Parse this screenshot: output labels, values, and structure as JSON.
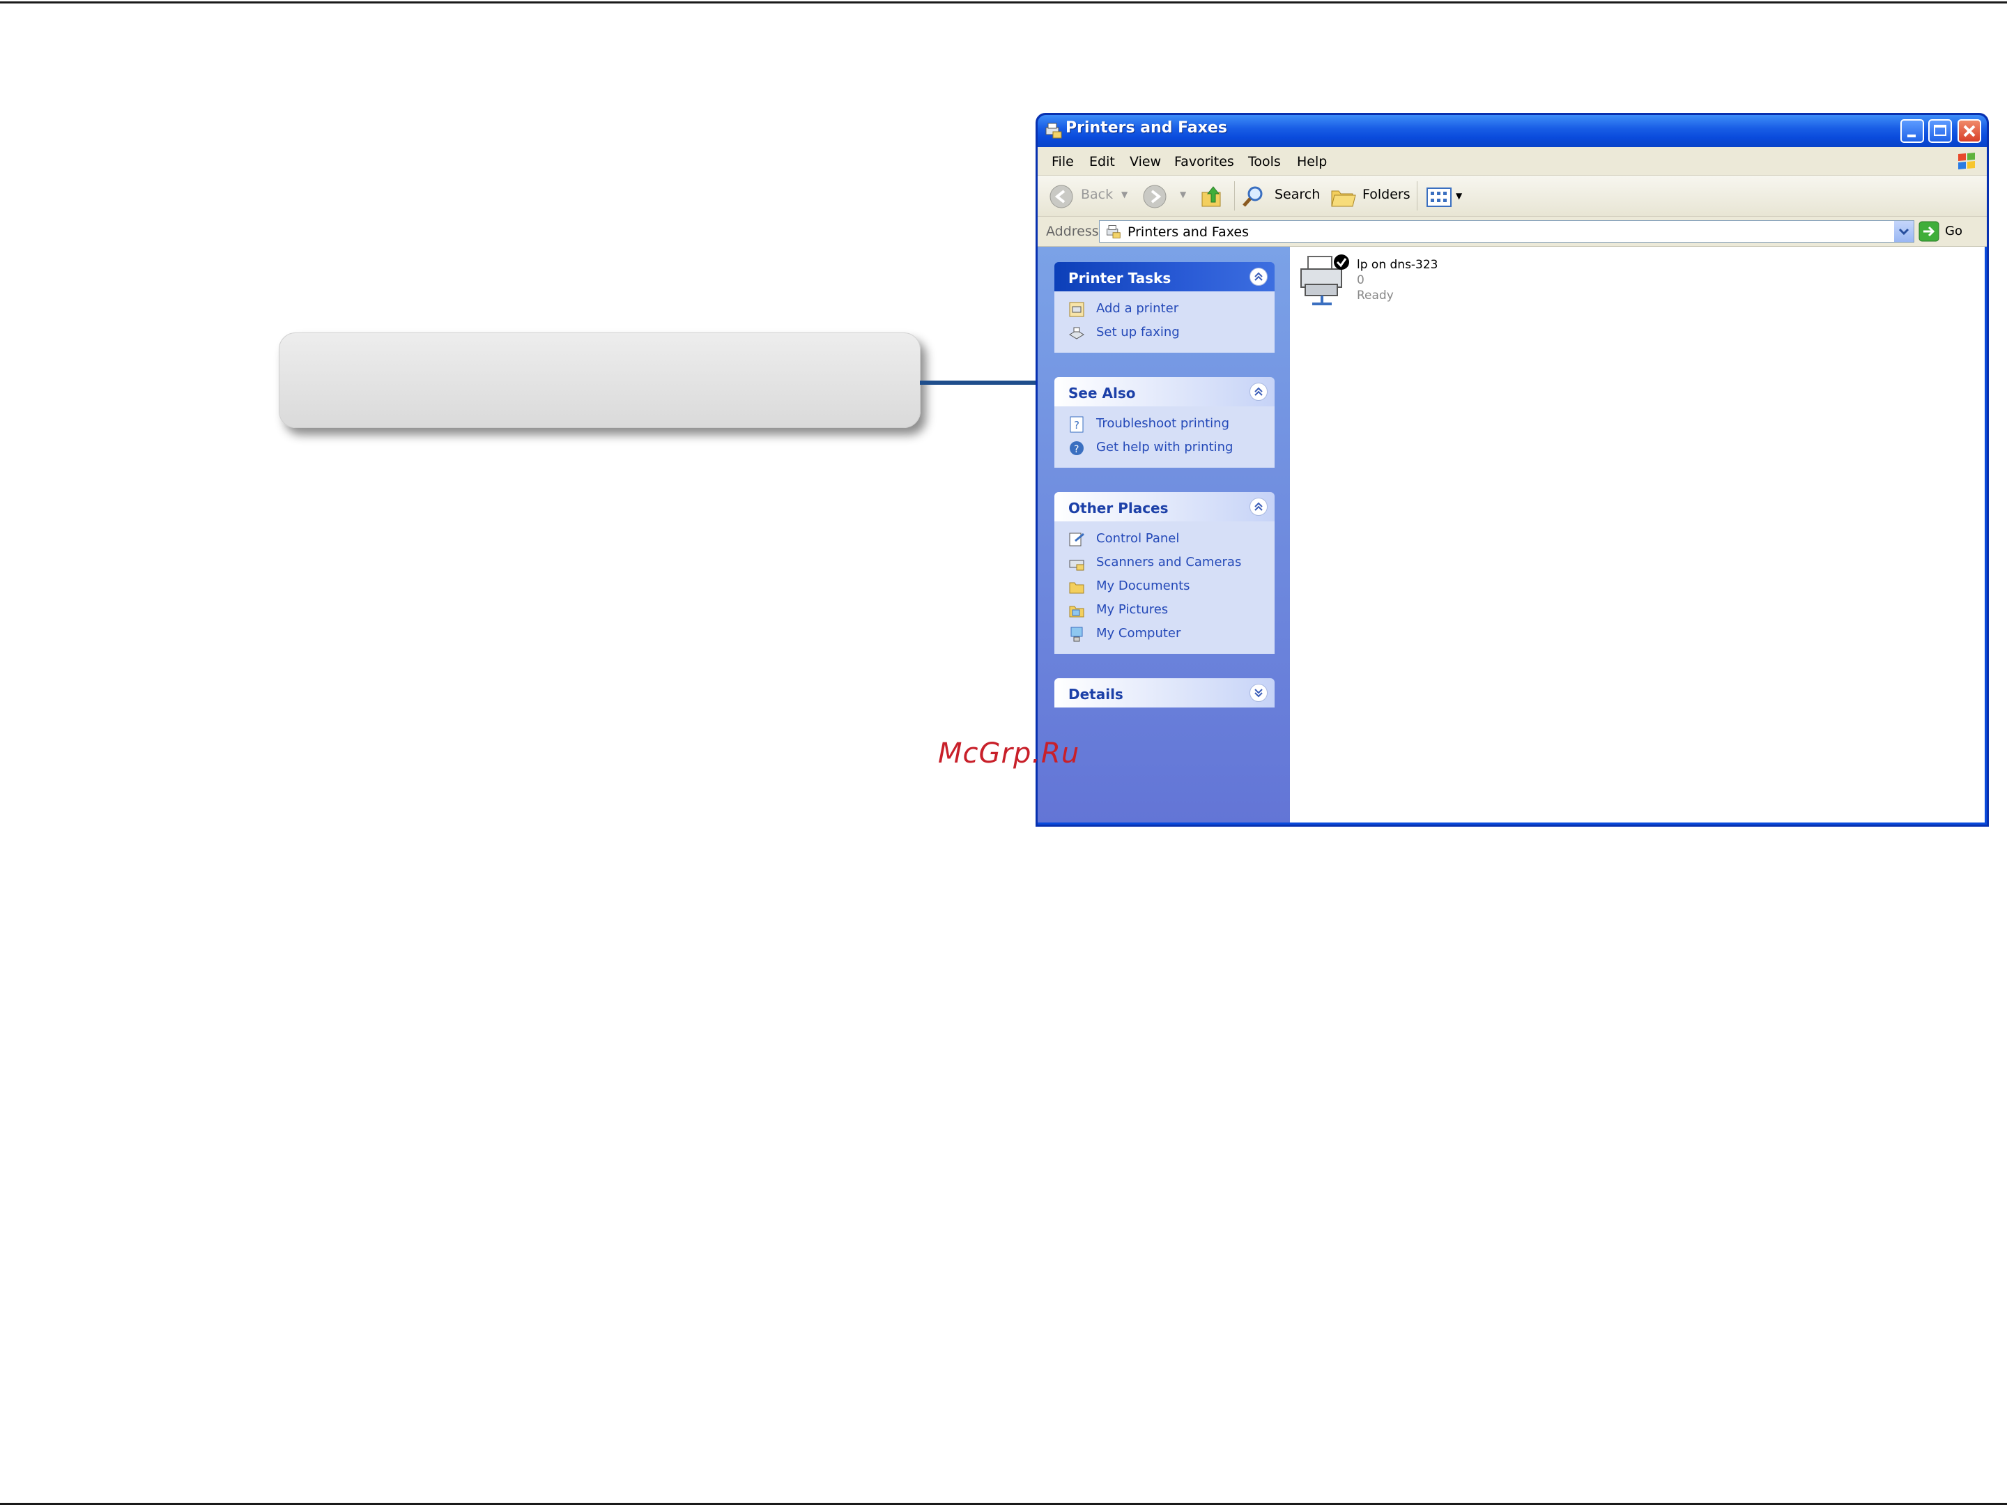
{
  "window": {
    "title": "Printers and Faxes",
    "menu": [
      "File",
      "Edit",
      "View",
      "Favorites",
      "Tools",
      "Help"
    ],
    "toolbar": {
      "back": "Back",
      "search": "Search",
      "folders": "Folders"
    },
    "address": {
      "label": "Address",
      "value": "Printers and Faxes",
      "go": "Go"
    }
  },
  "panels": [
    {
      "title": "Printer Tasks",
      "style": "dark",
      "items": [
        "Add a printer",
        "Set up faxing"
      ]
    },
    {
      "title": "See Also",
      "style": "light",
      "items": [
        "Troubleshoot printing",
        "Get help with printing"
      ]
    },
    {
      "title": "Other Places",
      "style": "light",
      "items": [
        "Control Panel",
        "Scanners and Cameras",
        "My Documents",
        "My Pictures",
        "My Computer"
      ]
    },
    {
      "title": "Details",
      "style": "light",
      "items": []
    }
  ],
  "printer": {
    "name": "lp on dns-323",
    "jobs": "0",
    "status": "Ready"
  },
  "watermark": "McGrp.Ru",
  "colors": {
    "accent": "#0a4bdc",
    "link": "#2449b8",
    "connector": "#1f4e8c",
    "watermark": "#c8202a"
  }
}
